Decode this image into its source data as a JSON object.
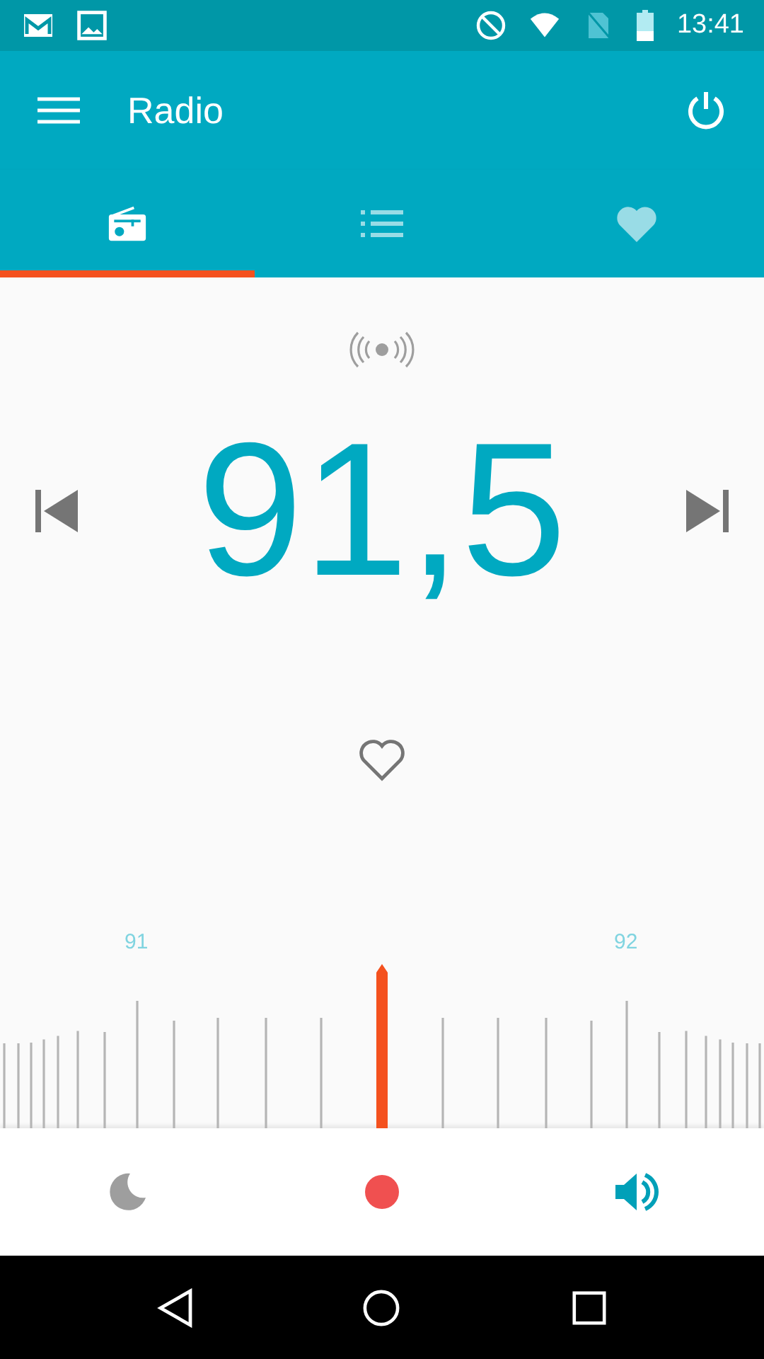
{
  "status_bar": {
    "time": "13:41"
  },
  "app_bar": {
    "title": "Radio"
  },
  "tabs": [
    {
      "kind": "radio",
      "selected": true
    },
    {
      "kind": "list",
      "selected": false
    },
    {
      "kind": "favorites",
      "selected": false
    }
  ],
  "station": {
    "frequency": "91,5",
    "favorite": false
  },
  "scale": {
    "labels": [
      "91",
      "92"
    ]
  },
  "bottom_actions": [
    {
      "kind": "sleep"
    },
    {
      "kind": "record"
    },
    {
      "kind": "speaker"
    }
  ]
}
